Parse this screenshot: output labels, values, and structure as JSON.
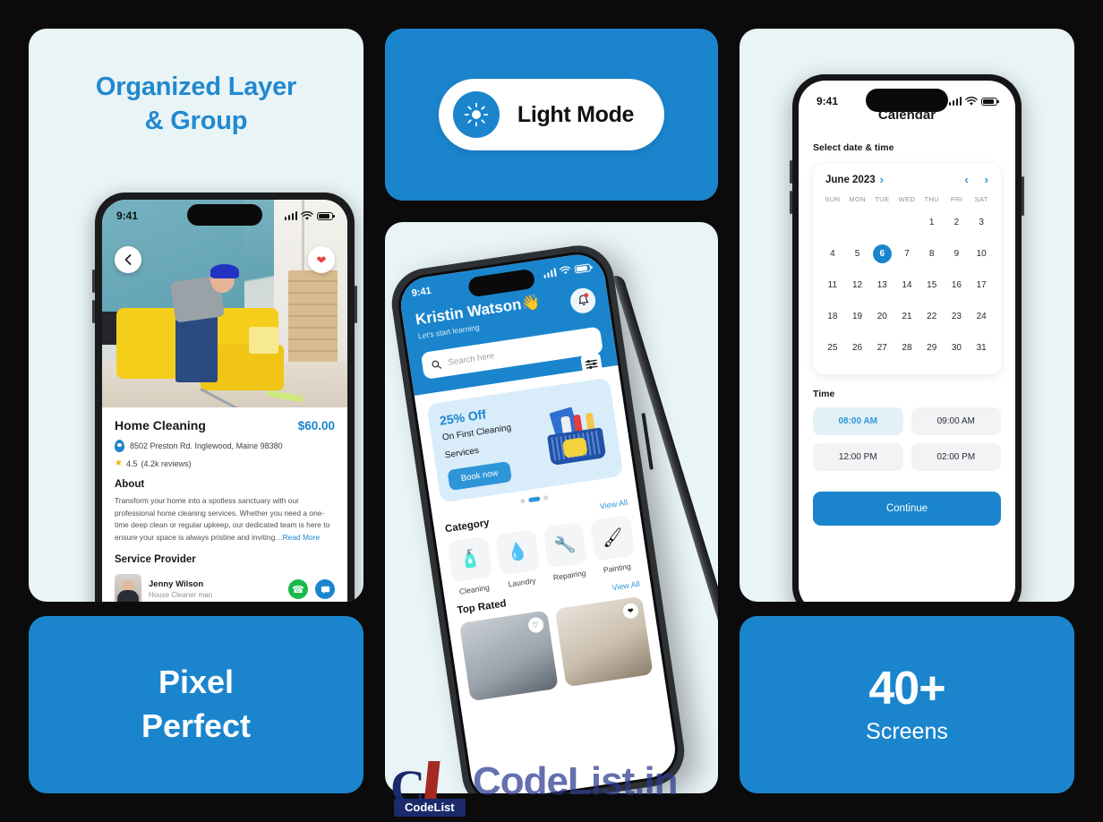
{
  "cards": {
    "organized": {
      "title_line1": "Organized Layer",
      "title_line2": "& Group"
    },
    "light_mode": {
      "label": "Light Mode",
      "icon": "sun-icon"
    },
    "pixel_perfect": {
      "line1": "Pixel",
      "line2": "Perfect"
    },
    "screens": {
      "count": "40+",
      "label": "Screens"
    }
  },
  "phone_detail": {
    "status_bar": {
      "time": "9:41",
      "signal_icon": "cellular-bars-icon",
      "wifi_icon": "wifi-icon",
      "battery_icon": "battery-icon"
    },
    "back_icon": "chevron-left-icon",
    "favorite_icon": "heart-icon",
    "service": {
      "title": "Home Cleaning",
      "price": "$60.00",
      "address": "8502 Preston Rd. Inglewood, Maine 98380",
      "location_icon": "map-pin-icon",
      "star_icon": "star-icon",
      "rating": "4.5",
      "reviews": "(4.2k reviews)",
      "about_heading": "About",
      "about_text": "Transform your home into a spotless sanctuary with our professional home cleaning services. Whether you need a one-time deep clean or regular upkeep, our dedicated team is here to ensure your space is always pristine and inviting…",
      "read_more": "Read More"
    },
    "provider": {
      "heading": "Service Provider",
      "avatar": "provider-avatar",
      "name": "Jenny Wilson",
      "role": "House Cleaner man",
      "call_icon": "phone-call-icon",
      "chat_icon": "chat-bubble-icon"
    }
  },
  "phone_home": {
    "status_bar": {
      "time": "9:41"
    },
    "greeting": "Kristin Watson",
    "greeting_emoji": "👋",
    "subtitle": "Let's start learning",
    "bell_icon": "notification-bell-icon",
    "filter_icon": "filter-sliders-icon",
    "search": {
      "placeholder": "Search here",
      "icon": "search-icon"
    },
    "promo": {
      "discount": "25% Off",
      "line1": "On First Cleaning",
      "line2": "Services",
      "button": "Book now"
    },
    "category": {
      "title": "Category",
      "view_all": "View All",
      "items": [
        {
          "label": "Cleaning",
          "icon": "cleaning-icon",
          "glyph": "🧴"
        },
        {
          "label": "Laundry",
          "icon": "laundry-icon",
          "glyph": "💧"
        },
        {
          "label": "Repairing",
          "icon": "repairing-icon",
          "glyph": "🔧"
        },
        {
          "label": "Painting",
          "icon": "painting-icon",
          "glyph": "🖌"
        }
      ]
    },
    "top_rated": {
      "title": "Top Rated",
      "view_all": "View All",
      "items": [
        {
          "favorite_icon": "heart-outline-icon"
        },
        {
          "favorite_icon": "heart-filled-icon"
        }
      ]
    }
  },
  "phone_calendar": {
    "status_bar": {
      "time": "9:41"
    },
    "title": "Calendar",
    "subtitle": "Select date & time",
    "month": "June 2023",
    "month_chevron_icon": "chevron-right-icon",
    "prev_icon": "chevron-left-icon",
    "next_icon": "chevron-right-icon",
    "weekdays": [
      "SUN",
      "MON",
      "TUE",
      "WED",
      "THU",
      "FRI",
      "SAT"
    ],
    "lead_blanks": 4,
    "days": [
      1,
      2,
      3,
      4,
      5,
      6,
      7,
      8,
      9,
      10,
      11,
      12,
      13,
      14,
      15,
      16,
      17,
      18,
      19,
      20,
      21,
      22,
      23,
      24,
      25,
      26,
      27,
      28,
      29,
      30,
      31
    ],
    "selected_day": 6,
    "time_heading": "Time",
    "time_slots": [
      {
        "label": "08:00 AM",
        "selected": true
      },
      {
        "label": "09:00 AM",
        "selected": false
      },
      {
        "label": "12:00 PM",
        "selected": false
      },
      {
        "label": "02:00 PM",
        "selected": false
      }
    ],
    "continue_label": "Continue"
  },
  "watermark": {
    "text": "CodeList.in",
    "badge": "CodeList",
    "mark": "C"
  },
  "colors": {
    "accent_blue": "#1a85cd",
    "light_card": "#e9f4f7",
    "background": "#0b0b0b",
    "green": "#18b84b",
    "star_yellow": "#f5b301",
    "slot_selected_bg": "#e3f1f7"
  }
}
